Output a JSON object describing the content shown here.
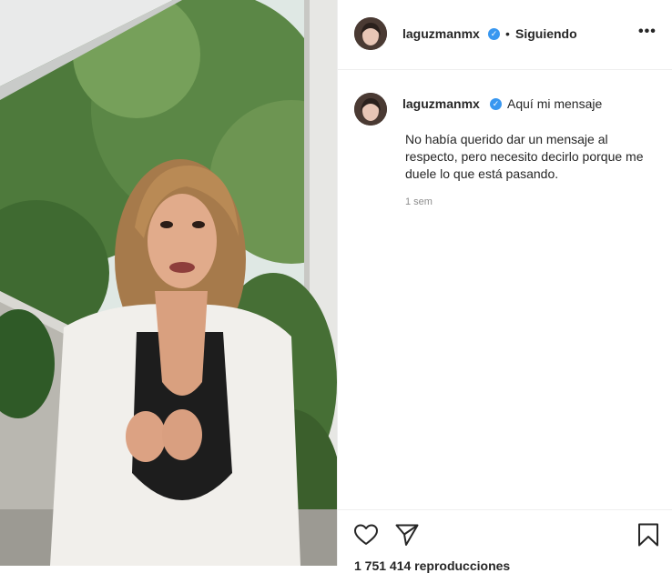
{
  "post": {
    "username": "laguzmanmx",
    "follow_status": "Siguiendo",
    "caption_title": "Aquí mi mensaje",
    "caption_body": "No había querido dar un mensaje al respecto, pero necesito decirlo porque me duele lo que está pasando.",
    "time_ago": "1 sem",
    "views": "1 751 414 reproducciones"
  },
  "icons": {
    "verified": "verified-badge-icon",
    "more": "more-options-icon",
    "like": "heart-icon",
    "share": "paper-plane-icon",
    "save": "bookmark-icon"
  },
  "colors": {
    "verified_blue": "#3897f0",
    "text": "#262626",
    "muted": "#8e8e8e",
    "divider": "#efefef"
  }
}
